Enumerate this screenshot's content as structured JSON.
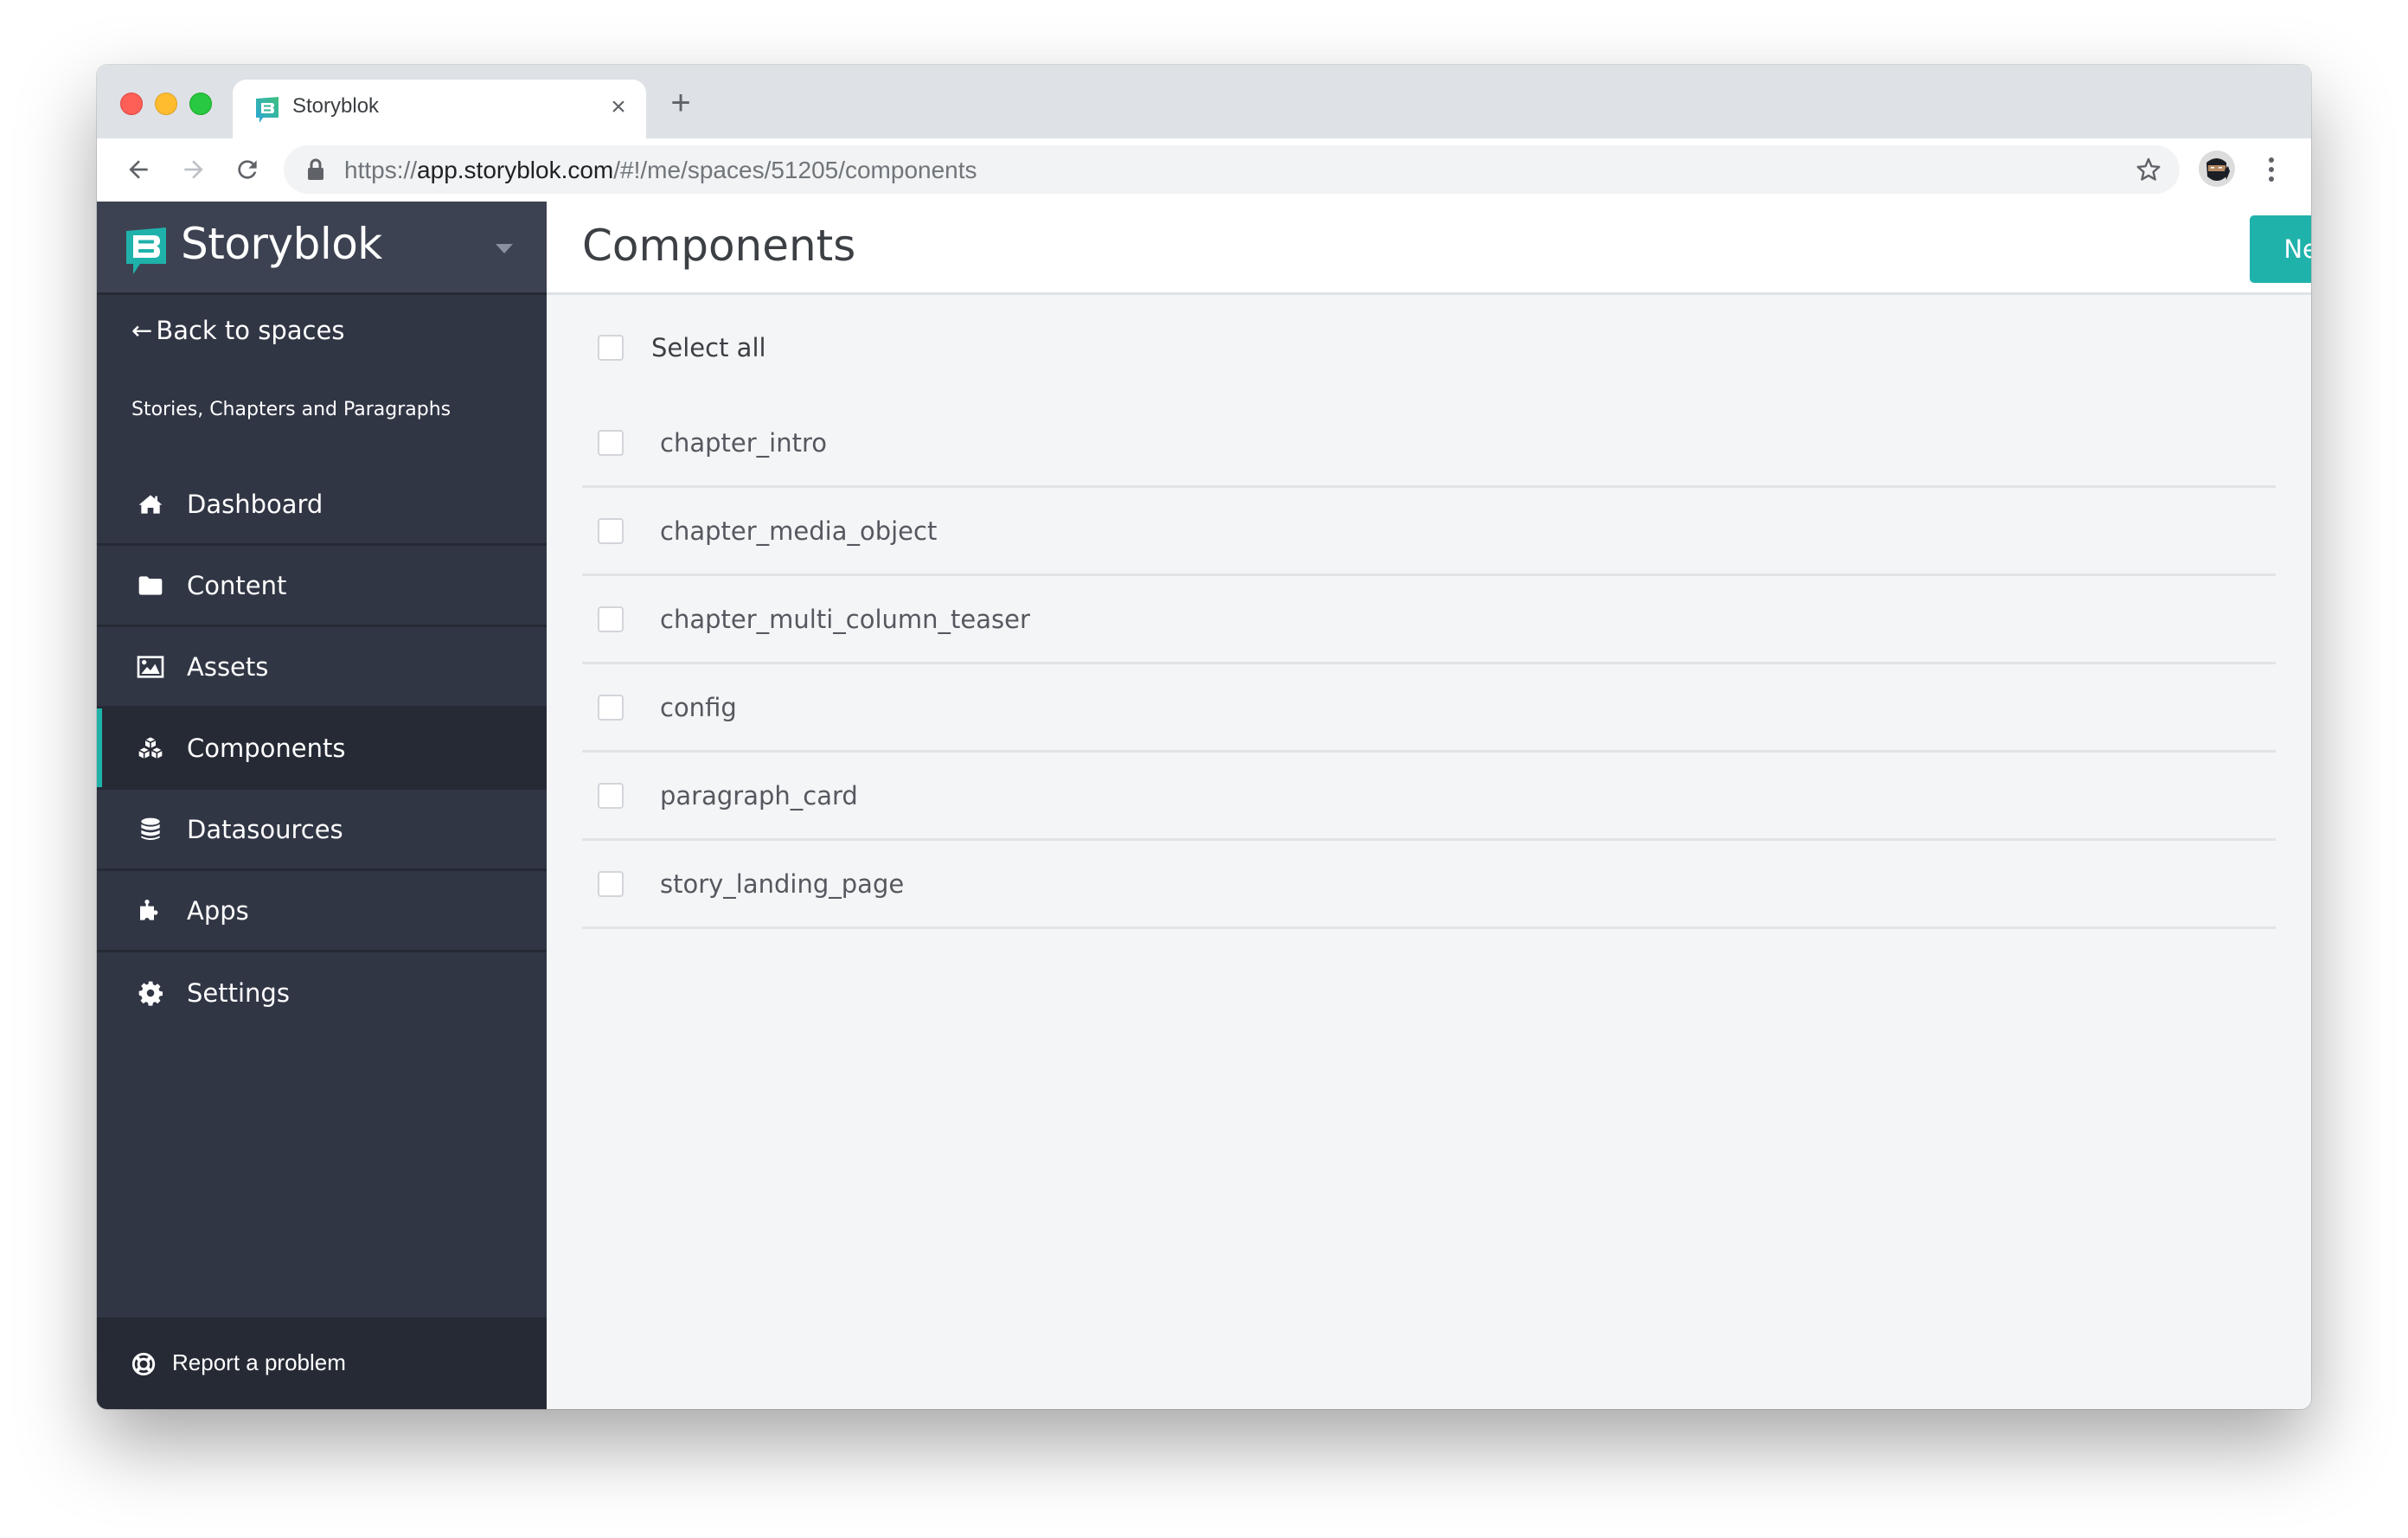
{
  "browser": {
    "tab": {
      "title": "Storyblok",
      "close_glyph": "×"
    },
    "new_tab_glyph": "+",
    "url": {
      "scheme": "https://",
      "host": "app.storyblok.com",
      "path": "/#!/me/spaces/51205/components"
    },
    "icons": [
      "back-arrow-icon",
      "forward-arrow-icon",
      "reload-icon",
      "lock-icon",
      "star-icon",
      "profile-avatar",
      "more-menu-icon"
    ]
  },
  "sidebar": {
    "brand": "Storyblok",
    "back_label": "Back to spaces",
    "back_arrow": "←",
    "space_name": "Stories, Chapters and Paragraphs",
    "items": [
      {
        "label": "Dashboard",
        "icon": "home-icon",
        "active": false
      },
      {
        "label": "Content",
        "icon": "folder-icon",
        "active": false
      },
      {
        "label": "Assets",
        "icon": "image-icon",
        "active": false
      },
      {
        "label": "Components",
        "icon": "cubes-icon",
        "active": true
      },
      {
        "label": "Datasources",
        "icon": "database-icon",
        "active": false
      },
      {
        "label": "Apps",
        "icon": "puzzle-icon",
        "active": false
      },
      {
        "label": "Settings",
        "icon": "gear-icon",
        "active": false
      }
    ],
    "footer_label": "Report a problem"
  },
  "main": {
    "title": "Components",
    "new_button": "New",
    "select_all_label": "Select all",
    "components": [
      "chapter_intro",
      "chapter_media_object",
      "chapter_multi_column_teaser",
      "config",
      "paragraph_card",
      "story_landing_page"
    ]
  },
  "colors": {
    "accent": "#1fb2ab",
    "sidebar_bg": "#313645",
    "sidebar_header_bg": "#3d4252",
    "sidebar_active_bg": "#262a35",
    "main_bg": "#f4f5f7"
  }
}
